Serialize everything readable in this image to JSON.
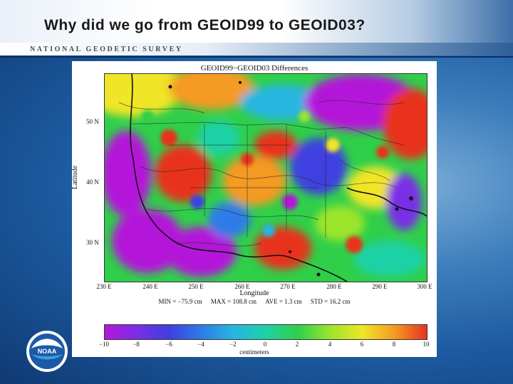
{
  "slide": {
    "title": "Why did we go from GEOID99 to GEOID03?",
    "agency": "NATIONAL GEODETIC SURVEY",
    "logo_text": "NOAA"
  },
  "figure": {
    "title": "GEOID99−GEOID03 Differences",
    "ylabel": "Latitude",
    "xlabel": "Longitude",
    "y_ticks": [
      "50 N",
      "40 N",
      "30 N"
    ],
    "x_ticks": [
      "230 E",
      "240 E",
      "250 E",
      "260 E",
      "270 E",
      "280 E",
      "290 E",
      "300 E"
    ],
    "stats": {
      "min": "MIN = −75.9 cm",
      "max": "MAX = 108.8 cm",
      "ave": "AVE = 1.3 cm",
      "std": "STD = 16.2 cm"
    },
    "colorbar": {
      "ticks": [
        "−10",
        "−8",
        "−6",
        "−4",
        "−2",
        "0",
        "2",
        "4",
        "6",
        "8",
        "10"
      ],
      "units": "centimeters",
      "colors": [
        "#b419d9",
        "#7a2ee6",
        "#3f3fe0",
        "#2f7be8",
        "#26b6e0",
        "#1fd1a5",
        "#2fcf4a",
        "#9be52c",
        "#f0e526",
        "#f59a21",
        "#e8321f"
      ]
    }
  }
}
